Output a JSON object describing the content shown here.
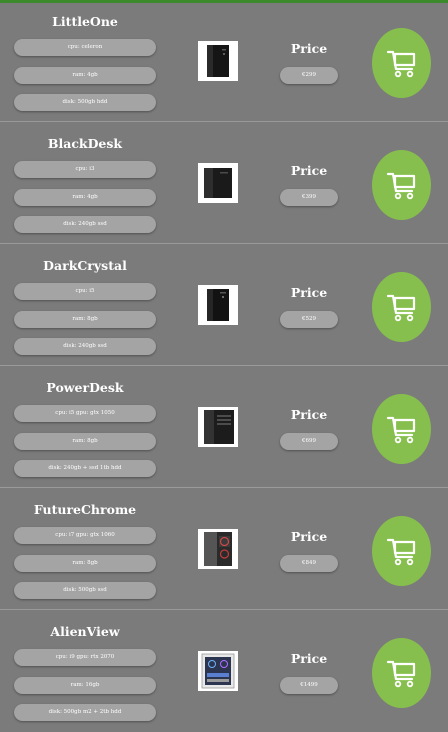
{
  "header": {
    "accent_color": "#3d8a2c"
  },
  "theme": {
    "background": "#7b7b7b",
    "pill": "#a4a4a4",
    "cart_button": "#86bf4d"
  },
  "products": [
    {
      "name": "LittleOne",
      "specs": [
        "cpu: celeron",
        "ram: 4gb",
        "disk: 500gb hdd"
      ],
      "image": "tower-pc-icon",
      "price_label": "Price",
      "price": "€299",
      "cart_icon": "shopping-cart-icon"
    },
    {
      "name": "BlackDesk",
      "specs": [
        "cpu: i3",
        "ram: 4gb",
        "disk: 240gb ssd"
      ],
      "image": "tower-pc-icon",
      "price_label": "Price",
      "price": "€399",
      "cart_icon": "shopping-cart-icon"
    },
    {
      "name": "DarkCrystal",
      "specs": [
        "cpu: i5",
        "ram: 8gb",
        "disk: 240gb ssd"
      ],
      "image": "tower-pc-icon",
      "price_label": "Price",
      "price": "€529",
      "cart_icon": "shopping-cart-icon"
    },
    {
      "name": "PowerDesk",
      "specs": [
        "cpu: i5 gpu: gtx 1050",
        "ram: 8gb",
        "disk: 240gb + ssd 1tb hdd"
      ],
      "image": "tower-pc-icon",
      "price_label": "Price",
      "price": "€699",
      "cart_icon": "shopping-cart-icon"
    },
    {
      "name": "FutureChrome",
      "specs": [
        "cpu: i7 gpu: gtx 1060",
        "ram: 8gb",
        "disk: 500gb ssd"
      ],
      "image": "gaming-pc-icon",
      "price_label": "Price",
      "price": "€849",
      "cart_icon": "shopping-cart-icon"
    },
    {
      "name": "AlienView",
      "specs": [
        "cpu: i9 gpu: rtx 2070",
        "ram: 16gb",
        "disk: 500gb m2 + 2tb hdd"
      ],
      "image": "gaming-pc-icon",
      "price_label": "Price",
      "price": "€1499",
      "cart_icon": "shopping-cart-icon"
    }
  ]
}
